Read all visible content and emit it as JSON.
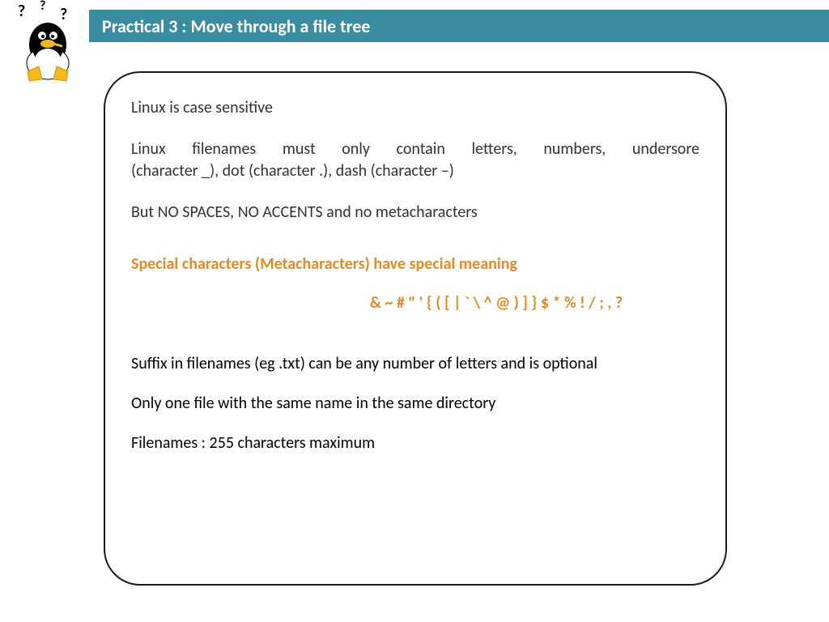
{
  "header": {
    "title": "Practical 3 : Move through a file tree"
  },
  "content": {
    "p1": "Linux is case sensitive",
    "p2a": "Linux filenames must only contain letters, numbers, undersore",
    "p2b": "(character _), dot (character .), dash (character –)",
    "p3": "But NO SPACES, NO ACCENTS and no metacharacters",
    "h1": "Special characters (Metacharacters) have special meaning",
    "meta": "& ~ # \" ' { ( [ | ` \\ ^ @ ) ] } $ * % ! / ; , ?",
    "p4": "Suffix in filenames (eg .txt) can be any number of letters and is optional",
    "p5": "Only one file with the same name in the same directory",
    "p6": "Filenames : 255 characters maximum"
  }
}
